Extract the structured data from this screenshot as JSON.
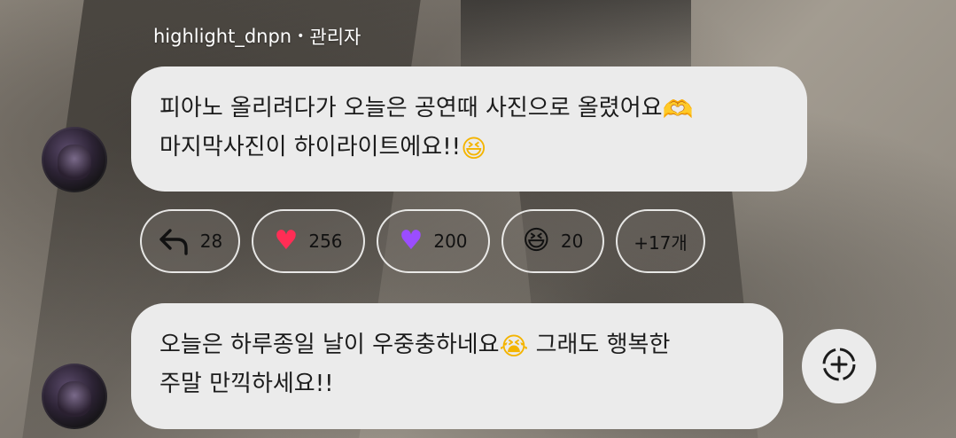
{
  "message1": {
    "username": "highlight_dnpn",
    "separator": "•",
    "role": "관리자",
    "line1": "피아노 올리려다가 오늘은 공연때 사진으로 올렸어요",
    "line1_emoji": "🫶",
    "line2": "마지막사진이 하이라이트에요!!",
    "line2_emoji": "😆"
  },
  "reactions": [
    {
      "icon": "reply-arrow-icon",
      "count": "28"
    },
    {
      "icon": "red-heart-icon",
      "glyph": "♥",
      "count": "256"
    },
    {
      "icon": "purple-heart-icon",
      "glyph": "♥",
      "count": "200"
    },
    {
      "icon": "grinning-squint-icon",
      "glyph": "😆",
      "count": "20"
    }
  ],
  "more_reactions_label": "+17개",
  "message2": {
    "line1": "오늘은 하루종일 날이 우중충하네요",
    "line1_emoji": "😭",
    "line1_after": " 그래도 행복한",
    "line2": "주말 만끽하세요!!"
  },
  "colors": {
    "bubble": "#ebebeb",
    "text": "#1c1c1c",
    "heart": "#ff2d55",
    "purple_heart": "#9b4dff"
  }
}
